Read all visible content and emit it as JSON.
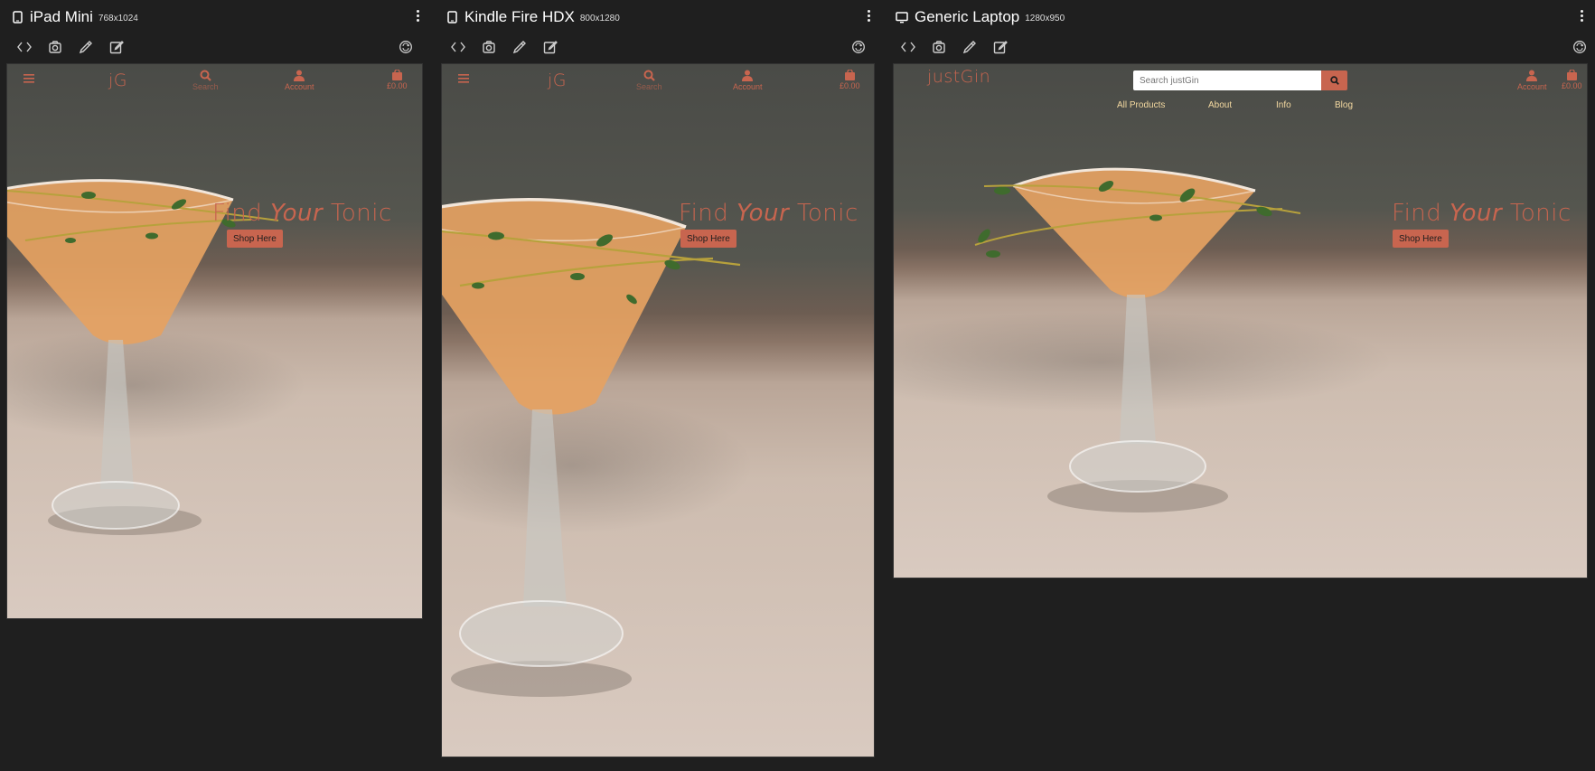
{
  "panels": [
    {
      "device_icon": "tablet-icon",
      "name": "iPad Mini",
      "dims": "768x1024",
      "nav": {
        "logo": "jG",
        "search_label": "Search",
        "account_label": "Account",
        "cart_label": "£0.00"
      },
      "hero": {
        "heading_pre": "Find ",
        "heading_em": "Your",
        "heading_post": " Tonic",
        "button": "Shop Here"
      }
    },
    {
      "device_icon": "tablet-icon",
      "name": "Kindle Fire HDX",
      "dims": "800x1280",
      "nav": {
        "logo": "jG",
        "search_label": "Search",
        "account_label": "Account",
        "cart_label": "£0.00"
      },
      "hero": {
        "heading_pre": "Find ",
        "heading_em": "Your",
        "heading_post": " Tonic",
        "button": "Shop Here"
      }
    },
    {
      "device_icon": "monitor-icon",
      "name": "Generic Laptop",
      "dims": "1280x950",
      "nav": {
        "logo": "justGin",
        "search_placeholder": "Search justGin",
        "account_label": "Account",
        "cart_label": "£0.00",
        "menu": [
          "All Products",
          "About",
          "Info",
          "Blog"
        ]
      },
      "hero": {
        "heading_pre": "Find ",
        "heading_em": "Your",
        "heading_post": " Tonic",
        "button": "Shop Here"
      }
    }
  ],
  "toolbar_icons": [
    "code-icon",
    "camera-icon",
    "eyedropper-icon",
    "edit-icon"
  ],
  "rotate_icon": "rotate-icon",
  "colors": {
    "accent": "#c8654f",
    "menu_link": "#f3d8a0",
    "background": "#1f1f1f"
  }
}
